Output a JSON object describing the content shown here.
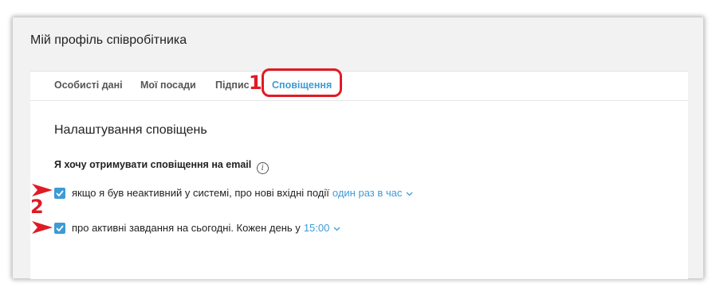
{
  "panel": {
    "title": "Мій профіль співробітника"
  },
  "tabs": [
    {
      "label": "Особисті дані",
      "active": false
    },
    {
      "label": "Мої посади",
      "active": false
    },
    {
      "label": "Підпис",
      "active": false
    },
    {
      "label": "Сповіщення",
      "active": true
    }
  ],
  "callouts": {
    "tab_marker": "1",
    "options_marker": "2"
  },
  "notifications": {
    "section_title": "Налаштування сповіщень",
    "email_label": "Я хочу отримувати сповіщення на email",
    "info_icon": "i",
    "options": [
      {
        "text": "якщо я був неактивний у системі, про нові вхідні події",
        "value": "один раз в час",
        "checked": true
      },
      {
        "text": "про активні завдання на сьогодні. Кожен день у",
        "value": "15:00",
        "checked": true
      }
    ]
  },
  "colors": {
    "accent": "#3d9bd6",
    "annotation": "#e01b24"
  }
}
